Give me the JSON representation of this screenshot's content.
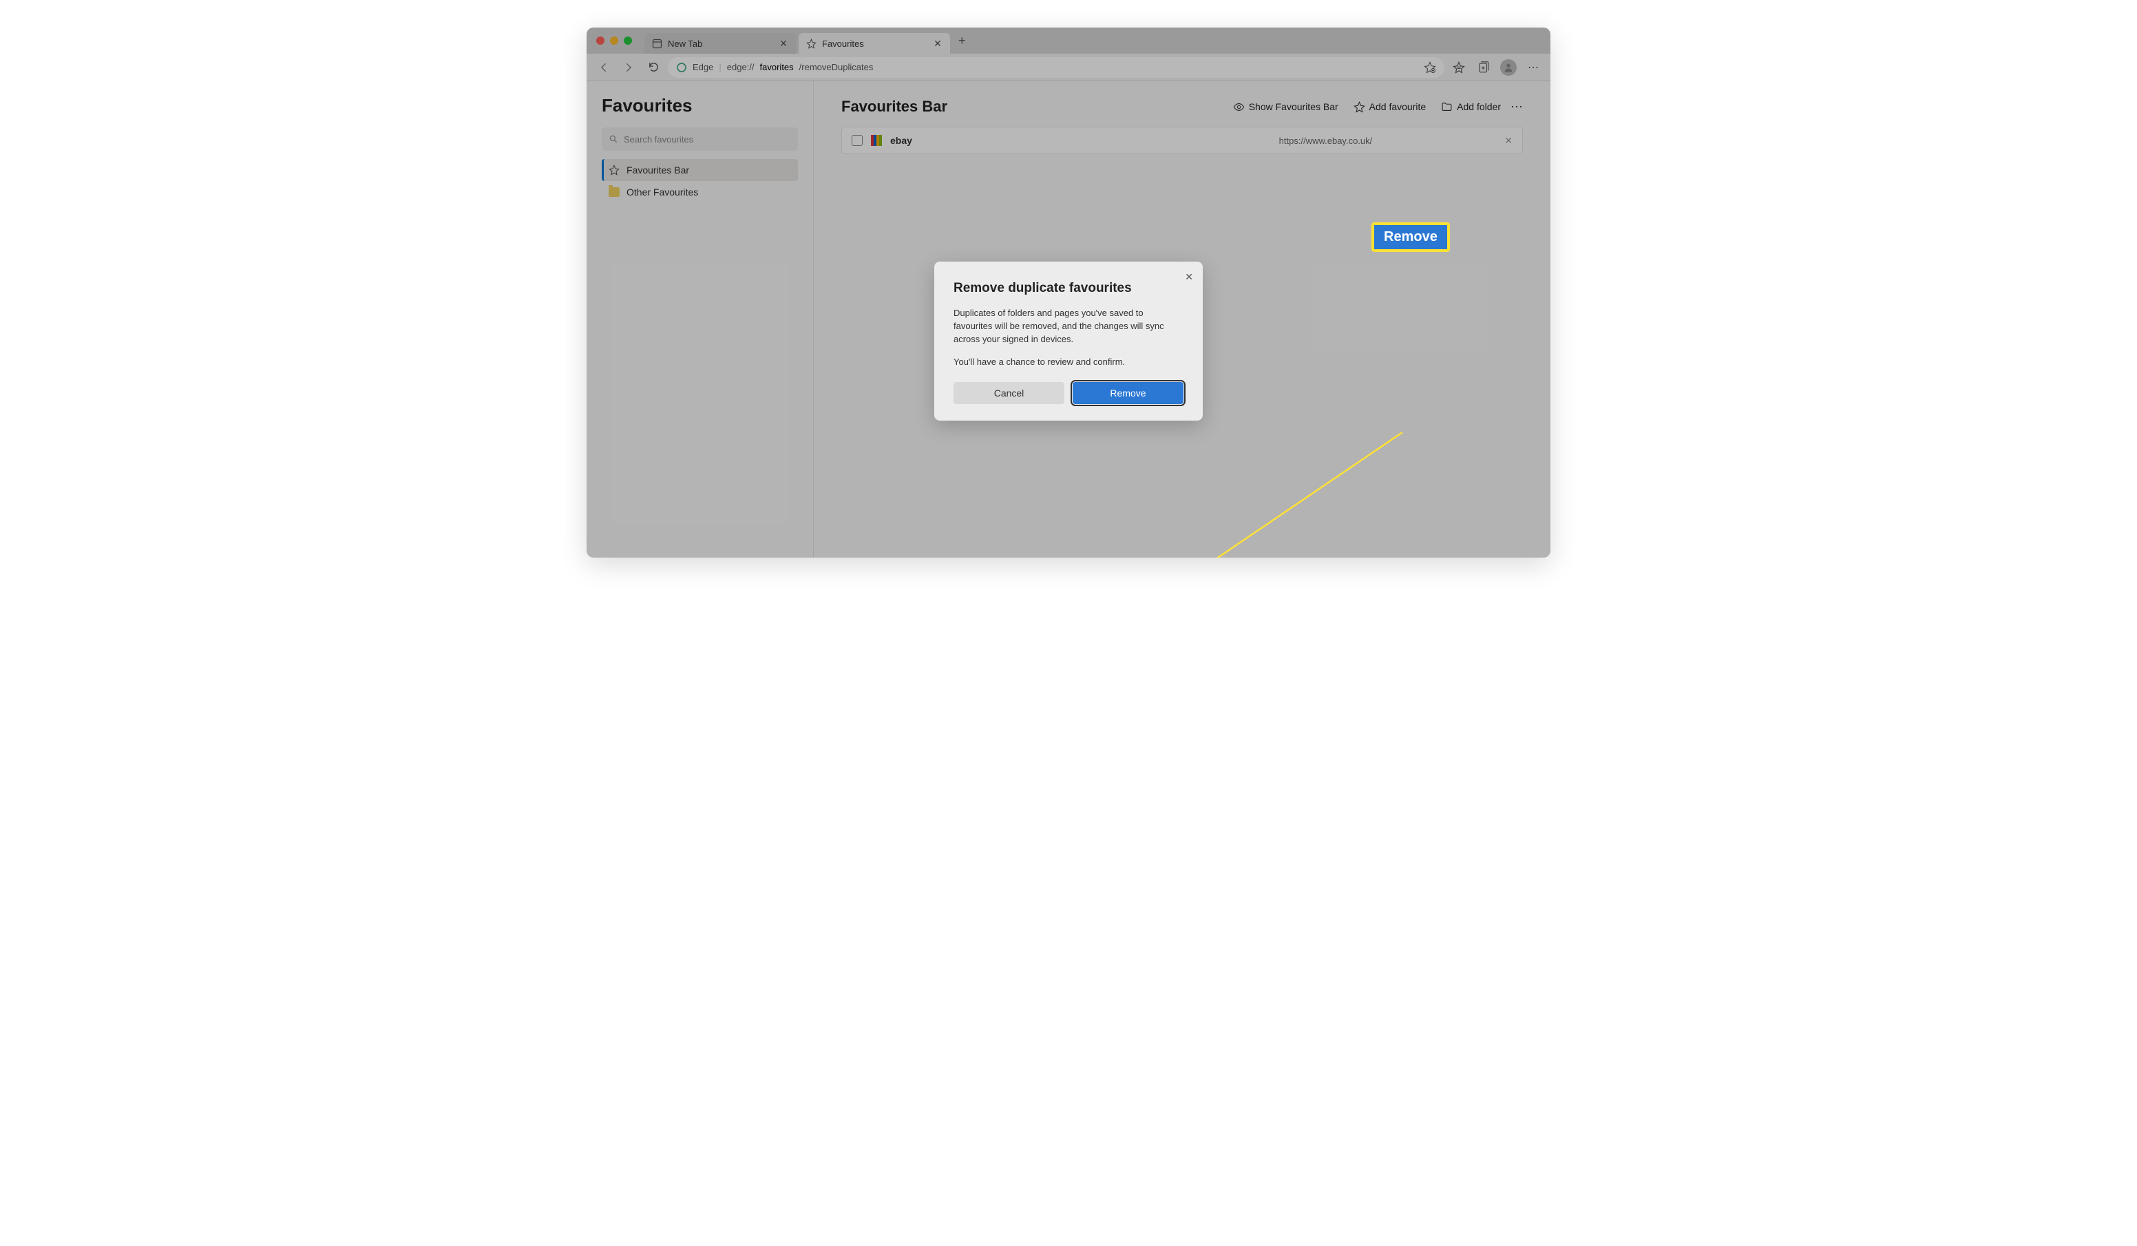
{
  "tabs": [
    {
      "label": "New Tab"
    },
    {
      "label": "Favourites"
    }
  ],
  "address": {
    "scheme": "Edge",
    "prefix": "edge://",
    "bold": "favorites",
    "suffix": "/removeDuplicates"
  },
  "sidebar": {
    "title": "Favourites",
    "search_placeholder": "Search favourites",
    "items": [
      {
        "label": "Favourites Bar"
      },
      {
        "label": "Other Favourites"
      }
    ]
  },
  "main": {
    "title": "Favourites Bar",
    "actions": {
      "show": "Show Favourites Bar",
      "add_fav": "Add favourite",
      "add_folder": "Add folder"
    },
    "favourite": {
      "name": "ebay",
      "url": "https://www.ebay.co.uk/"
    }
  },
  "dialog": {
    "title": "Remove duplicate favourites",
    "text1": "Duplicates of folders and pages you've saved to favourites will be removed, and the changes will sync across your signed in devices.",
    "text2": "You'll have a chance to review and confirm.",
    "cancel": "Cancel",
    "remove": "Remove"
  },
  "callout": {
    "label": "Remove"
  }
}
